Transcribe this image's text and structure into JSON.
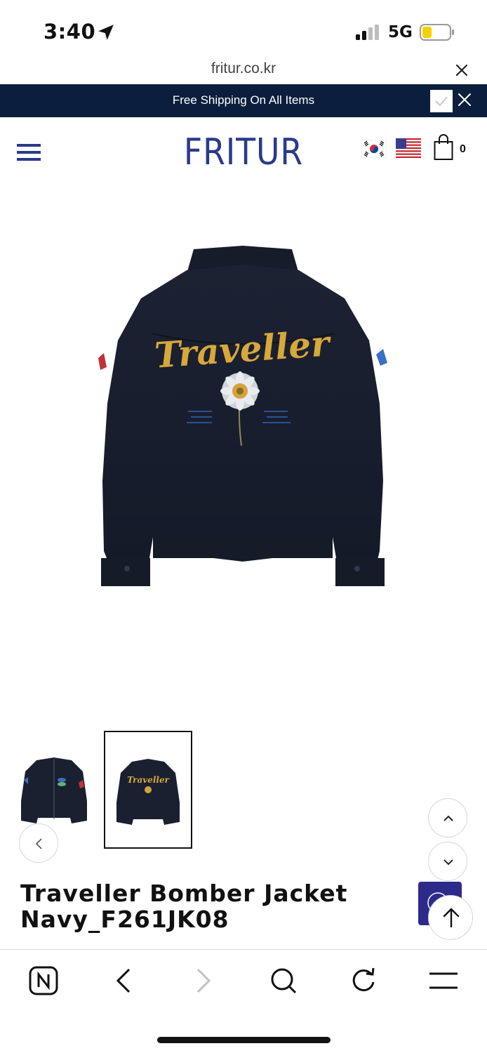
{
  "status_bar": {
    "time": "3:40",
    "network": "5G",
    "icons": [
      "location-arrow-icon",
      "signal-icon",
      "battery-icon"
    ]
  },
  "browser": {
    "url": "fritur.co.kr",
    "close_icon": "close-icon"
  },
  "banner": {
    "text": "Free Shipping On All Items",
    "background": "#0b1e3d"
  },
  "header": {
    "logo": "FRITUR",
    "logo_color": "#2a3a8a",
    "cart_count": "0",
    "icons": [
      "hamburger-menu-icon",
      "korea-flag-icon",
      "usa-flag-icon",
      "shopping-bag-icon"
    ]
  },
  "product": {
    "image_text": "Traveller",
    "title_line1": "Traveller Bomber Jacket",
    "title_line2": "Navy_F261JK08",
    "thumbnails": [
      "jacket-front",
      "jacket-back"
    ],
    "selected_thumbnail": 2,
    "thumb_text": "Traveller"
  },
  "toolbar": {
    "icons": [
      "naver-home-icon",
      "back-icon",
      "forward-icon",
      "search-icon",
      "reload-icon",
      "menu-icon"
    ]
  }
}
